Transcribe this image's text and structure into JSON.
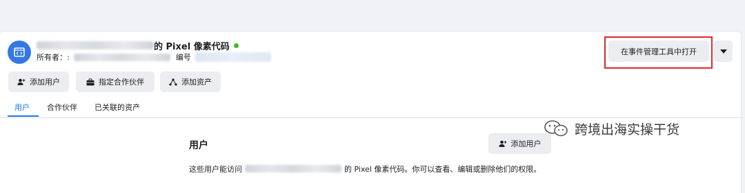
{
  "header": {
    "title_suffix": "的 Pixel 像素代码",
    "owner_label": "所有者：:",
    "id_label": "编号"
  },
  "actions": {
    "open_in_events_manager": "在事件管理工具中打开",
    "add_user": "添加用户",
    "assign_partner": "指定合作伙伴",
    "add_asset": "添加资产"
  },
  "tabs": [
    {
      "label": "用户",
      "active": true
    },
    {
      "label": "合作伙伴",
      "active": false
    },
    {
      "label": "已关联的资产",
      "active": false
    }
  ],
  "users_section": {
    "title": "用户",
    "add_user_label": "添加用户",
    "description_prefix": "这些用户能访问",
    "description_suffix": "的 Pixel 像素代码。你可以查看、编辑或删除他们的权限。"
  },
  "watermark": {
    "text": "跨境出海实操干货",
    "icon": "wechat-icon"
  },
  "colors": {
    "accent": "#1877f2",
    "avatar_bg": "#3578e5",
    "status_active": "#42b72a",
    "highlight_box": "#e0282a"
  }
}
